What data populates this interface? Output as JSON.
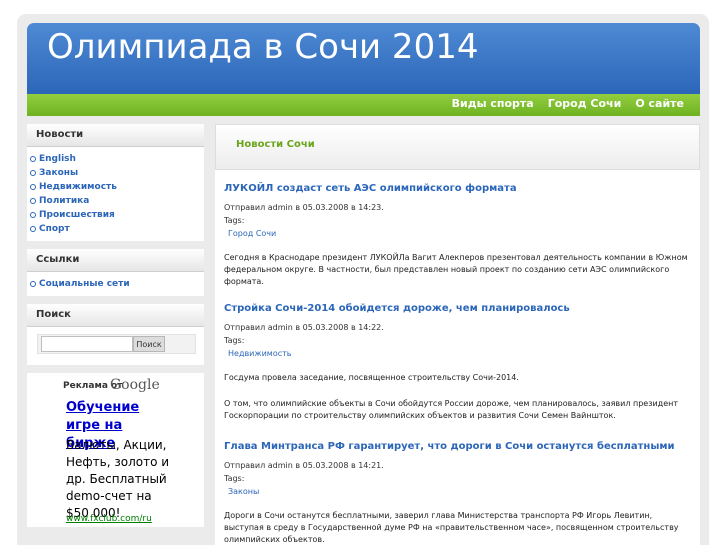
{
  "site": {
    "title": "Олимпиада в Сочи 2014"
  },
  "nav": [
    "Виды спорта",
    "Город Сочи",
    "О сайте"
  ],
  "sidebar": {
    "news": {
      "title": "Новости",
      "items": [
        "English",
        "Законы",
        "Недвижимость",
        "Политика",
        "Происшествия",
        "Спорт"
      ]
    },
    "links": {
      "title": "Ссылки",
      "items": [
        "Социальные сети"
      ]
    },
    "search": {
      "title": "Поиск",
      "button": "Поиск",
      "value": ""
    },
    "ad": {
      "by": "Реклама от",
      "brand": "Google",
      "headline": "Обучение игре на бирже",
      "body": "Валюты, Акции, Нефть, золото и др. Бесплатный demo-счет на $50 000!",
      "url": "www.fxclub.com/ru"
    }
  },
  "main": {
    "section_title": "Новости Сочи",
    "tags_label": "Tags:",
    "articles": [
      {
        "title": "ЛУКОЙЛ создаст сеть АЭС олимпийского формата",
        "meta": "Отправил admin в 05.03.2008 в 14:23.",
        "tag": "Город Сочи",
        "paragraphs": [
          "Сегодня в Краснодаре президент ЛУКОЙЛа Вагит Алекперов презентовал деятельность компании в Южном федеральном округе. В частности, был представлен новый проект по созданию сети АЭС олимпийского формата."
        ]
      },
      {
        "title": "Стройка Сочи-2014 обойдется дороже, чем планировалось",
        "meta": "Отправил admin в 05.03.2008 в 14:22.",
        "tag": "Недвижимость",
        "paragraphs": [
          "Госдума провела заседание, посвященное строительству Сочи-2014.",
          "О том, что олимпийские объекты в Сочи обойдутся России дороже, чем планировалось, заявил президент Госкорпорации по строительству олимпийских объектов и развития Сочи Семен Вайншток."
        ]
      },
      {
        "title": "Глава Минтранса РФ гарантирует, что дороги в Сочи останутся бесплатными",
        "meta": "Отправил admin в 05.03.2008 в 14:21.",
        "tag": "Законы",
        "paragraphs": [
          "Дороги в Сочи останутся бесплатными, заверил глава Министерства транспорта РФ Игорь Левитин, выступая в среду в Государственной думе РФ на «правительственном часе», посвященном строительству олимпийских объектов."
        ]
      }
    ]
  }
}
